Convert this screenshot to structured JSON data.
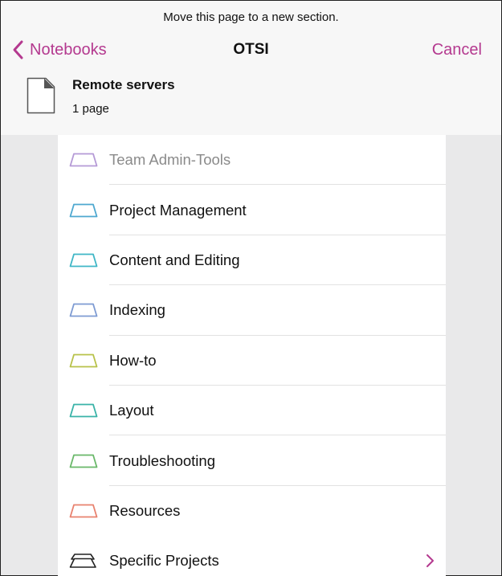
{
  "header": {
    "prompt": "Move this page to a new section.",
    "back_label": "Notebooks",
    "title": "OTSI",
    "cancel_label": "Cancel"
  },
  "page": {
    "name": "Remote servers",
    "count": "1 page"
  },
  "colors": {
    "accent": "#b4398f"
  },
  "sections": [
    {
      "label": "Team Admin-Tools",
      "color": "#b59ad6",
      "dimmed": true
    },
    {
      "label": "Project Management",
      "color": "#4ea8d0",
      "dimmed": false
    },
    {
      "label": "Content and Editing",
      "color": "#3fb6c6",
      "dimmed": false
    },
    {
      "label": "Indexing",
      "color": "#7e9bd3",
      "dimmed": false
    },
    {
      "label": "How-to",
      "color": "#b8c24a",
      "dimmed": false
    },
    {
      "label": "Layout",
      "color": "#3ab3a8",
      "dimmed": false
    },
    {
      "label": "Troubleshooting",
      "color": "#6ab86a",
      "dimmed": false
    },
    {
      "label": "Resources",
      "color": "#e8826f",
      "dimmed": false
    }
  ],
  "group": {
    "label": "Specific Projects",
    "icon": "section-group-icon",
    "chevron_icon": "chevron-right-icon"
  }
}
